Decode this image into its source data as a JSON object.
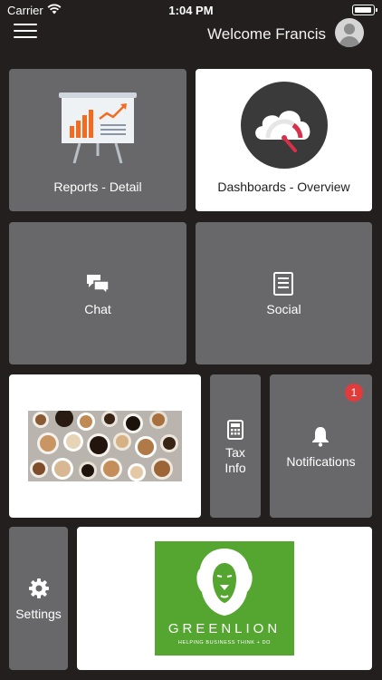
{
  "status_bar": {
    "carrier": "Carrier",
    "time": "1:04 PM"
  },
  "header": {
    "welcome": "Welcome Francis"
  },
  "tiles": {
    "reports": "Reports - Detail",
    "dashboards": "Dashboards - Overview",
    "chat": "Chat",
    "social": "Social",
    "tax": "Tax\nInfo",
    "notifications": "Notifications",
    "notifications_badge": "1",
    "settings": "Settings"
  },
  "greenlion": {
    "name": "GREENLION",
    "tagline": "HELPING BUSINESS THINK + DO"
  },
  "colors": {
    "background": "#221f1e",
    "tile_grey": "#68686a",
    "tile_white": "#ffffff",
    "badge": "#e23b3b",
    "greenlion_green": "#55a630",
    "chart_orange": "#f26b21"
  },
  "icons": {
    "menu": "hamburger-icon",
    "avatar": "user-avatar-icon",
    "reports": "presentation-chart-icon",
    "dashboards": "cloud-gauge-icon",
    "chat": "chat-bubbles-icon",
    "social": "document-icon",
    "tax": "calculator-icon",
    "notifications": "bell-icon",
    "settings": "gear-icon"
  }
}
